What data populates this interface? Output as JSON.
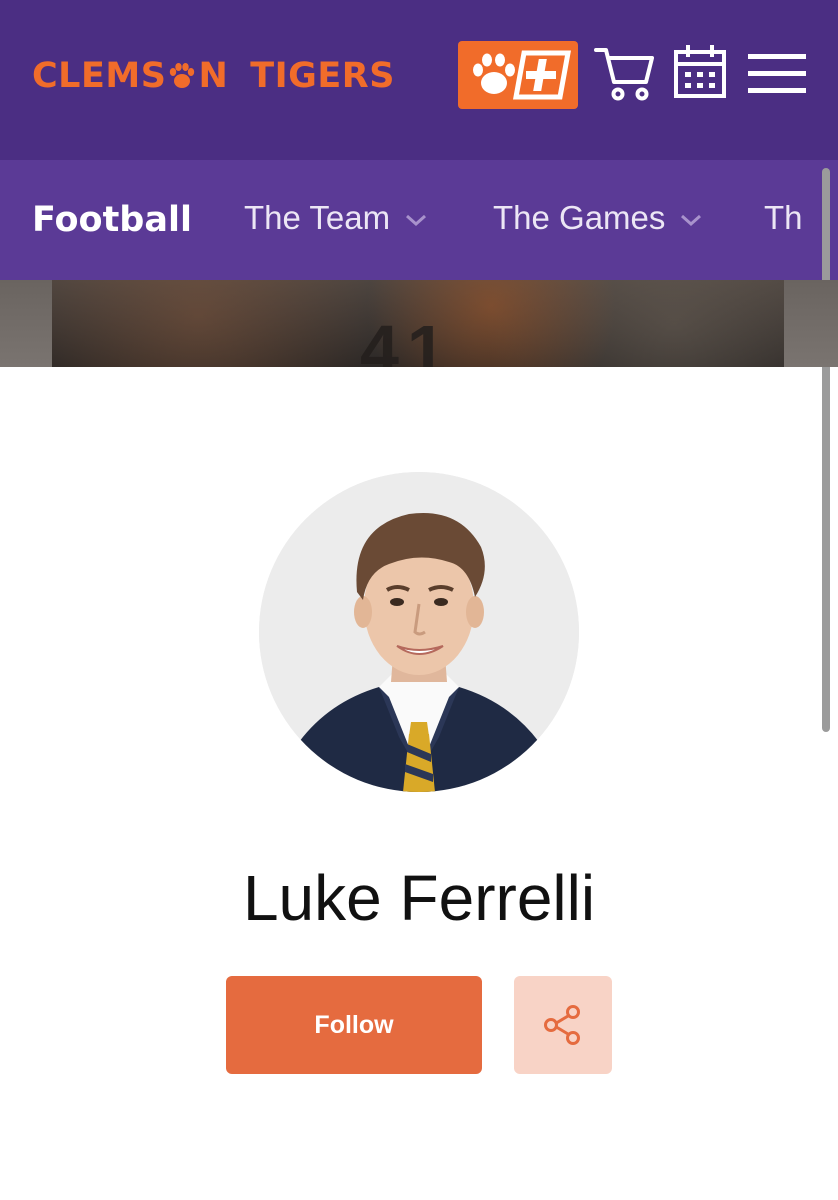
{
  "header": {
    "brand_part1": "CLEMS",
    "brand_part2": "N",
    "brand_part3": "TIGERS",
    "brand_paw_icon": "paw-icon",
    "plus_button_icon": "clemson-plus-icon",
    "cart_icon": "cart-icon",
    "calendar_icon": "calendar-icon",
    "menu_icon": "hamburger-menu-icon",
    "colors": {
      "background": "#4b2e83",
      "brand": "#f16c2a"
    }
  },
  "subnav": {
    "title": "Football",
    "items": [
      {
        "label": "The Team",
        "has_dropdown": true
      },
      {
        "label": "The Games",
        "has_dropdown": true
      },
      {
        "label": "Th"
      }
    ],
    "background": "#5b3a96"
  },
  "profile": {
    "name": "Luke Ferrelli",
    "follow_label": "Follow",
    "share_icon": "share-icon",
    "colors": {
      "follow": "#e56b3f",
      "share_bg": "#f8d3c6"
    }
  },
  "hero": {
    "jersey_number": "41"
  }
}
